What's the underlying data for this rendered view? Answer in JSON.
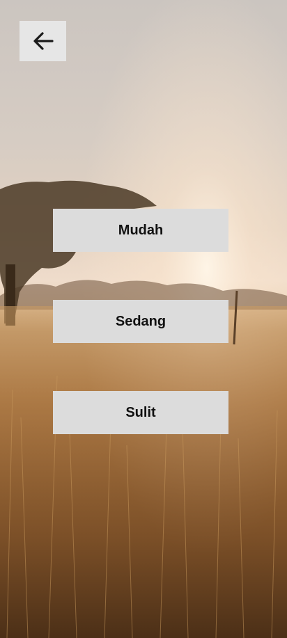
{
  "theme": {
    "button_bg": "#dcdcdc",
    "back_button_bg": "#e6e6e6",
    "text_color": "#111111",
    "icon_color": "#1a1a1a"
  },
  "header": {
    "back_icon": "arrow-left-icon"
  },
  "difficulty": {
    "options": [
      {
        "label": "Mudah"
      },
      {
        "label": "Sedang"
      },
      {
        "label": "Sulit"
      }
    ]
  }
}
